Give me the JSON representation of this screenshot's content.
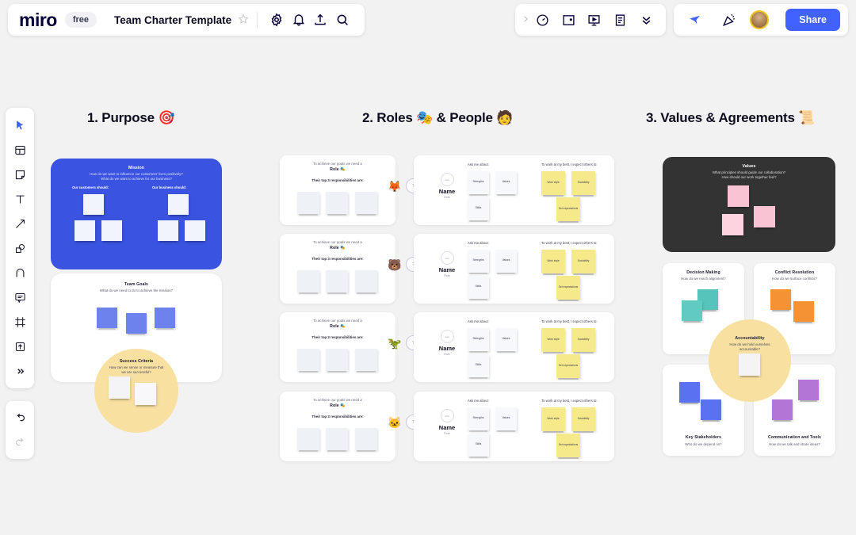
{
  "topbar": {
    "logo": "miro",
    "plan_badge": "free",
    "board_title": "Team Charter Template",
    "icons_left": [
      "star-icon",
      "gear-icon",
      "bell-icon",
      "upload-icon",
      "search-icon"
    ],
    "icons_mid": [
      "chevron-right-icon",
      "timer-icon",
      "frame-add-icon",
      "present-icon",
      "notes-icon",
      "double-chevron-down-icon"
    ],
    "icons_right": [
      "cursor-share-icon",
      "party-popper-icon",
      "avatar"
    ],
    "share_label": "Share"
  },
  "toolbar": {
    "items": [
      {
        "name": "select-tool",
        "glyph": "cursor"
      },
      {
        "name": "templates-tool",
        "glyph": "templates"
      },
      {
        "name": "sticky-note-tool",
        "glyph": "sticky"
      },
      {
        "name": "text-tool",
        "glyph": "text"
      },
      {
        "name": "line-arrow-tool",
        "glyph": "arrow"
      },
      {
        "name": "shapes-tool",
        "glyph": "shapes"
      },
      {
        "name": "pen-tool",
        "glyph": "pen"
      },
      {
        "name": "comment-tool",
        "glyph": "comment"
      },
      {
        "name": "frame-tool",
        "glyph": "frame"
      },
      {
        "name": "upload-tool",
        "glyph": "upload"
      },
      {
        "name": "more-tools",
        "glyph": "more"
      }
    ],
    "history": [
      {
        "name": "undo-button",
        "glyph": "undo"
      },
      {
        "name": "redo-button",
        "glyph": "redo"
      }
    ]
  },
  "sections": [
    {
      "id": "purpose",
      "title": "1. Purpose 🎯"
    },
    {
      "id": "roles",
      "title": "2. Roles 🎭 & People 🧑"
    },
    {
      "id": "values",
      "title": "3. Values & Agreements 📜"
    }
  ],
  "purpose": {
    "mission": {
      "title": "Mission",
      "subtitle": "How do we want to influence our customers' lives positively?\nWhat do we want to achieve for our business?",
      "col_left": "Our customers should:",
      "col_right": "Our business should:",
      "bg_color": "#3a53e0",
      "note_color": "#f2f4fb"
    },
    "goals": {
      "title": "Team Goals",
      "subtitle": "What do we need to do to achieve the mission?",
      "note_color": "#6e82ee"
    },
    "success": {
      "title": "Success Criteria",
      "subtitle": "How can we sense or measure that\nwe are successful?",
      "circle_color": "#f7e0a0",
      "note_color": "#f4f4f6"
    }
  },
  "roles": {
    "role_card": {
      "line1": "To achieve our goals we need a",
      "line2": "Role 🎭",
      "line3": "Their top 3 responsibilities are:",
      "note_color": "#eef2f7"
    },
    "people_card": {
      "name": "Name",
      "role_sub": "Role",
      "tag": "add",
      "ask_heading": "Ask me about:",
      "ask_notes": [
        "Strengths",
        "Values",
        "Skills"
      ],
      "expect_heading": "To work at my best, I expect others to:",
      "expect_notes": [
        "Work style",
        "Sociability",
        "Set expectations"
      ],
      "ask_note_color": "#f7f8fb",
      "expect_note_color": "#f6e98a"
    },
    "rows": [
      {
        "emoji": "🦊",
        "badge": "?"
      },
      {
        "emoji": "🐻",
        "badge": "?"
      },
      {
        "emoji": "🦖",
        "badge": "?"
      },
      {
        "emoji": "🐱",
        "badge": "?"
      }
    ]
  },
  "values": {
    "values_card": {
      "title": "Values",
      "subtitle": "What principles should guide our collaboration?\nHow should our work together feel?",
      "bg_color": "#333333",
      "note_color": "#f9c3d4"
    },
    "quad": [
      {
        "title": "Decision Making",
        "subtitle": "How do we reach alignment?",
        "note_color": "#57c4bb",
        "label_pos": "top"
      },
      {
        "title": "Conflict Resolution",
        "subtitle": "How do we surface conflicts?",
        "note_color": "#f59233",
        "label_pos": "top"
      },
      {
        "title": "Key Stakeholders",
        "subtitle": "Who do we depend on?",
        "note_color": "#5b72f0",
        "label_pos": "bottom"
      },
      {
        "title": "Communication and Tools",
        "subtitle": "How do we talk and share ideas?",
        "note_color": "#b476d6",
        "label_pos": "bottom"
      }
    ],
    "accountability": {
      "title": "Accountability",
      "subtitle": "How do we hold ourselves\naccountable?",
      "circle_color": "#f7e0a0",
      "note_color": "#f4f4f6"
    }
  },
  "colors": {
    "canvas_bg": "#f2f2f2",
    "accent": "#4262ff",
    "text_dark": "#050038"
  }
}
